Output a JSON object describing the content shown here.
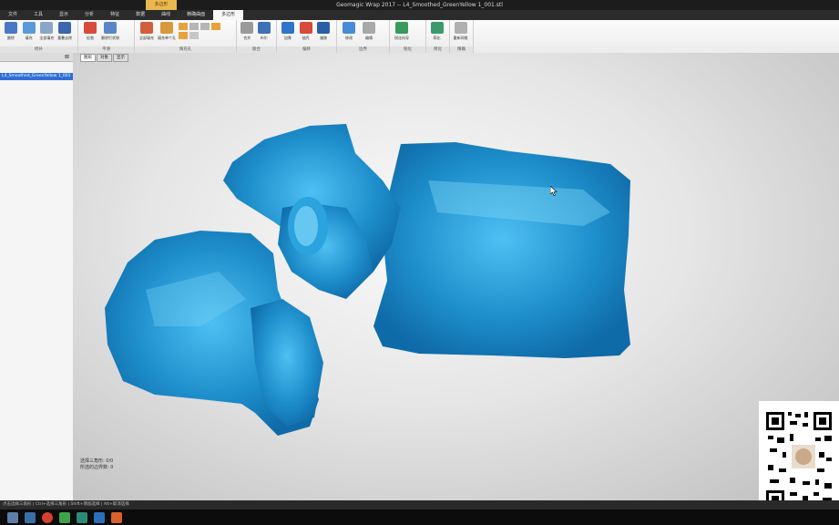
{
  "window": {
    "title": "Geomagic Wrap 2017 -- L4_Smoothed_GreenYellow 1_001.stl"
  },
  "menu": {
    "context_tab": "多边形",
    "items": [
      "文件",
      "工具",
      "显示",
      "分析",
      "特征",
      "数据",
      "曲线",
      "精确曲面",
      "多边形"
    ]
  },
  "ribbon": {
    "groups": [
      {
        "label": "修补",
        "buttons": [
          "删除",
          "填充",
          "全部填充",
          "重叠去除"
        ]
      },
      {
        "label": "平滑",
        "buttons": [
          "松弛",
          "删除钉状物"
        ]
      },
      {
        "label": "填充孔",
        "buttons": [
          "全部填充",
          "填充单个孔"
        ]
      },
      {
        "label": "联合",
        "buttons": [
          "合并",
          "布尔"
        ]
      },
      {
        "label": "偏移",
        "buttons": [
          "加厚",
          "抽壳",
          "偏移"
        ]
      },
      {
        "label": "边界",
        "buttons": [
          "修改",
          "编辑"
        ]
      },
      {
        "label": "锐化",
        "buttons": [
          "锐化向导"
        ]
      },
      {
        "label": "简化",
        "buttons": [
          "简化"
        ]
      },
      {
        "label": "精确",
        "buttons": [
          "重新网格"
        ]
      }
    ],
    "colors": {
      "accent_blue": "#2e74c8",
      "accent_red": "#d64b3c",
      "accent_green": "#3a9a5e",
      "accent_orange": "#e8a23a"
    }
  },
  "sidebar": {
    "header": "",
    "selected_item": "L4_Smoothed_GreenYellow 1_001"
  },
  "viewport": {
    "tabs": [
      "图形",
      "对象",
      "显示"
    ],
    "stats_line1": "选择三角形: 0/0",
    "stats_line2": "所选的边界数: 0",
    "model_color": "#1e8fcc"
  },
  "statusbar": {
    "text": "点击选择三角形 | Ctrl+选择三角形 | Shift+增加选择 | Alt+取消选择"
  },
  "taskbar": {
    "icons": [
      "calculator-icon",
      "explorer-icon",
      "chrome-icon",
      "wechat-icon",
      "geomagic-icon",
      "app-icon",
      "wps-icon"
    ]
  }
}
